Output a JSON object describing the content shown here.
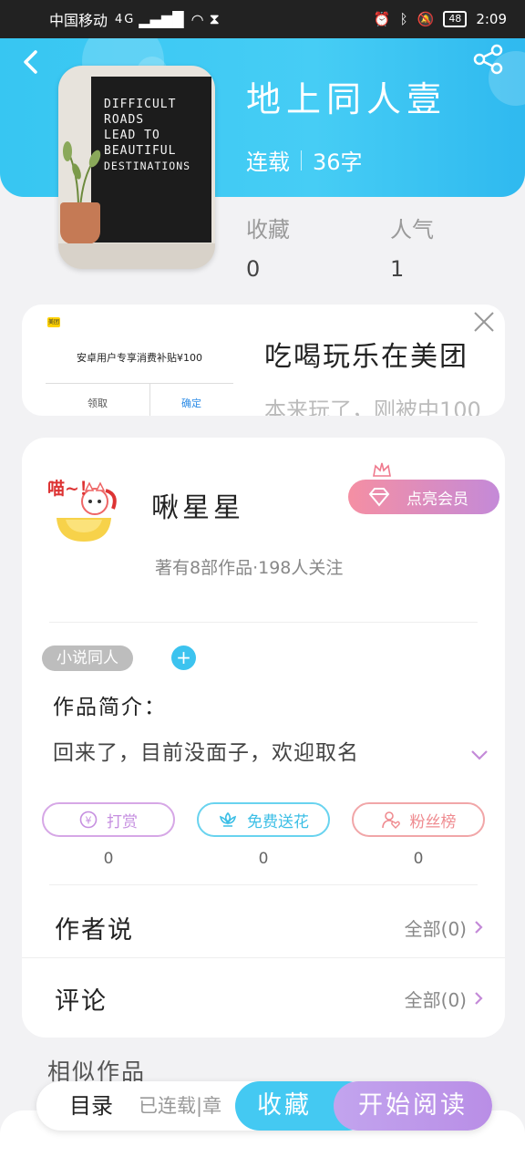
{
  "status_bar": {
    "carrier": "中国移动",
    "network": "4G",
    "battery": "48",
    "time": "2:09"
  },
  "book": {
    "title": "地上同人壹",
    "serial_status": "连载",
    "word_count": "36字",
    "cover_text": [
      "DIFFICULT",
      "ROADS",
      "LEAD TO",
      "BEAUTIFUL",
      "DESTINATIONS"
    ],
    "stats": [
      {
        "label": "收藏",
        "value": "0"
      },
      {
        "label": "人气",
        "value": "1"
      }
    ]
  },
  "ad": {
    "brand_logo": "美团",
    "offer_text": "安卓用户专享消费补贴¥100",
    "claim_label": "领取",
    "confirm_label": "确定",
    "headline": "吃喝玩乐在美团",
    "subline": "本来玩了，刚被中100"
  },
  "author": {
    "name": "啾星星",
    "avatar_text": "喵~！",
    "vip_label": "点亮会员",
    "meta": "著有8部作品·198人关注"
  },
  "tags": {
    "items": [
      "小说同人"
    ],
    "add_label": "+"
  },
  "intro": {
    "label": "作品简介：",
    "text": "回来了，目前没面子，欢迎取名"
  },
  "actions": [
    {
      "label": "打赏",
      "count": "0",
      "icon": "yen-coin-icon",
      "color": "#c68fe0"
    },
    {
      "label": "免费送花",
      "count": "0",
      "icon": "flower-icon",
      "color": "#3cbfe6"
    },
    {
      "label": "粉丝榜",
      "count": "0",
      "icon": "user-heart-icon",
      "color": "#ef8b90"
    }
  ],
  "sections": {
    "author_says": {
      "title": "作者说",
      "more": "全部(0)"
    },
    "comments": {
      "title": "评论",
      "more": "全部(0)"
    }
  },
  "similar": {
    "title": "相似作品"
  },
  "bottom_bar": {
    "toc_label": "目录",
    "toc_status": "已连载|章",
    "favorite_label": "收藏",
    "read_label": "开始阅读"
  },
  "colors": {
    "header_blue": "#37c6f2",
    "accent_purple": "#c48ad8",
    "accent_pink": "#f58fa3"
  }
}
